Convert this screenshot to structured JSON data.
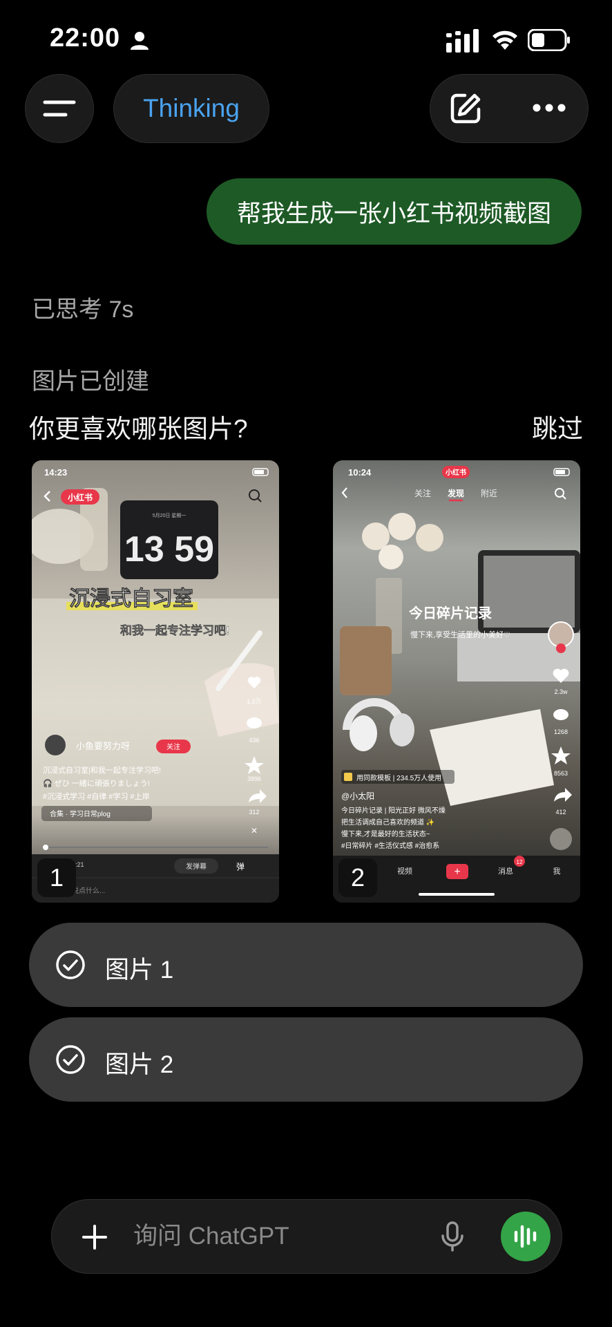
{
  "status_bar": {
    "time": "22:00"
  },
  "top_bar": {
    "model_label": "Thinking"
  },
  "chat": {
    "user_message": "帮我生成一张小红书视频截图",
    "thought_time": "已思考 7s",
    "image_created": "图片已创建",
    "question": "你更喜欢哪张图片?",
    "skip_label": "跳过"
  },
  "image1": {
    "number": "1",
    "time": "14:23",
    "brand": "小红书",
    "date_line": "5月20日 星期一",
    "clock": "13 59",
    "headline": "沉浸式自习室",
    "subheadline": "和我一起专注学习吧!",
    "likes": "1.2万",
    "comments": "436",
    "stars": "3896",
    "shares": "312",
    "author": "小鱼要努力呀",
    "follow": "关注",
    "caption_1": "沉浸式自习室|和我一起专注学习吧!",
    "caption_2": "🎧 ぜひ 一緒に頑張りましょう!",
    "caption_3": "#沉浸式学习 #自律 #学习 #上岸",
    "collection": "合集 · 学习日常plog",
    "progress_time": "0:21",
    "danmaku_button": "发弹幕",
    "danmaku_toggle": "弹",
    "comment_placeholder": "说点什么..."
  },
  "image2": {
    "number": "2",
    "time": "10:24",
    "brand": "小红书",
    "tabs": [
      "关注",
      "发现",
      "附近"
    ],
    "overlay_title": "今日碎片记录",
    "overlay_sub": "慢下来,享受生活里的小美好♡",
    "likes": "2.3w",
    "comments": "1268",
    "stars": "8563",
    "shares": "412",
    "template_tag": "用同款模板 | 234.5万人使用",
    "author": "@小太阳",
    "caption_1": "今日碎片记录 | 阳光正好 微风不燥",
    "caption_2": "把生活调成自己喜欢的频道 ✨",
    "caption_3": "慢下来,才是最好的生活状态~",
    "hashtags": "#日常碎片 #生活仪式感 #治愈系",
    "nav": [
      "视频",
      "消息",
      "我"
    ],
    "message_badge": "12"
  },
  "options": [
    {
      "label": "图片 1"
    },
    {
      "label": "图片 2"
    }
  ],
  "composer": {
    "placeholder": "询问 ChatGPT"
  },
  "colors": {
    "background": "#000000",
    "user_bubble": "#1e5a26",
    "accent_blue": "#4aa3f0",
    "voice_button": "#33a447",
    "option_bg": "#3a3a3a"
  }
}
